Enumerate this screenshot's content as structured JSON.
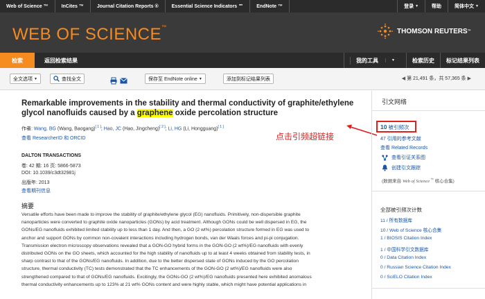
{
  "topnav": {
    "items": [
      "Web of Science ™",
      "InCites ™",
      "Journal Citation Reports ®",
      "Essential Science Indicators ℠",
      "EndNote ™"
    ],
    "right": {
      "login": "登录",
      "help": "帮助",
      "language": "简体中文"
    }
  },
  "header": {
    "brand": "WEB OF SCIENCE",
    "brand_tm": "™",
    "publisher": "THOMSON REUTERS",
    "publisher_tm": "™"
  },
  "subnav": {
    "search_tab": "检索",
    "back": "返回检索结果",
    "my_tools": "我的工具",
    "history": "检索历史",
    "marked_list": "标记结果列表"
  },
  "toolbar": {
    "fulltext_options": "全文选项",
    "find_fulltext": "查找全文",
    "save_to": "保存至 EndNote online",
    "add_marked": "添加到标记结果列表",
    "page_count": "第 21,491 条，共 57,365 条"
  },
  "record": {
    "title_before": "Remarkable improvements in the stability and thermal conductivity of graphite/ethylene glycol nanofluids caused by a ",
    "title_highlight": "graphene",
    "title_after": " oxide percolation structure",
    "authors_label": "作者:",
    "authors": [
      {
        "name": "Wang, BG",
        "full": " (Wang, Baogang)",
        "ref": "[ 1 ]"
      },
      {
        "name": "Hao, JC",
        "full": " (Hao, Jingcheng)",
        "ref": "[ 2 ]"
      },
      {
        "name": "Li, HG",
        "full": " (Li, Hongguang)",
        "ref": "[ 1 ]"
      }
    ],
    "researcher_id": "查看 ResearcherID 和 ORCID",
    "journal": "DALTON TRANSACTIONS",
    "volume_line": "卷: 42  期: 16  页: 5866-5873",
    "doi_line": "DOI: 10.1039/c3dt32981j",
    "year_line": "出版年: 2013",
    "journal_info": "查看期刊信息",
    "abstract_head": "摘要",
    "abstract_lines": [
      "Versatile efforts have been made to improve the stability of graphite/ethylene glycol (EG) nanofluids. Primitively, non-dispersible graphite",
      "nanoparticles were converted to graphite oxide nanoparticles (GONs) by acid treatment. Although GONs could be well dispersed in EG, the",
      "GONs/EG nanofluids exhibited limited stability up to less than 1 day. And then, a GO (2 wt%) percolation structure formed in EG was used to",
      "anchor and support GONs by common non-covalent interactions including hydrogen bonds, van der Waals forces and pi-pi conjugation.",
      "Transmission electron microscopy observations revealed that a GON-GO hybrid forms in the GON-GO (2 wt%)/EG nanofluids with evenly",
      "distributed GONs on the GO sheets, which accounted for the high stability of nanofluids up to at least 4 weeks obtained from stability tests, in",
      "sharp contrast to that of the GONs/EG nanofluids. In addition, due to the better dispersed state of GONs induced by the GO percolation",
      "structure, thermal conductivity (TC) tests demonstrated that the TC enhancements of the GON-GO (2 wt%)/EG nanofluids were also",
      "strengthened compared to that of GONs/EG nanofluids. Excitingly, the GONs-GO (2 wt%)/EG nanofluids presented here exhibited anomalous",
      "thermal conductivity enhancements up to 123% at 21 wt% GONs content and were highly stable, which might have potential applications in"
    ]
  },
  "annotation": "点击引频超链接",
  "sidebar": {
    "header": "引文网络",
    "times_cited_num": "10",
    "times_cited_label": " 被引频次",
    "references": "47 引用的参考文献",
    "related": "查看 Related Records",
    "citation_map": "查看引证关系图",
    "alert": "创建引文跟踪",
    "data_note_before": "(数据来自 ",
    "data_note_italic": "Web of Science",
    "data_note_tm": " ™",
    "data_note_after": " 核心合集)",
    "all_counts_title": "全部被引频次计数",
    "counts": [
      "11 / 所有数据库",
      "10 / Web of Science 核心合集",
      "1 / BIOSIS Citation Index",
      "1 / 中国科学引文数据库",
      "0 / Data Citation Index",
      "0 / Russian Science Citation Index",
      "0 / SciELO Citation Index"
    ]
  }
}
